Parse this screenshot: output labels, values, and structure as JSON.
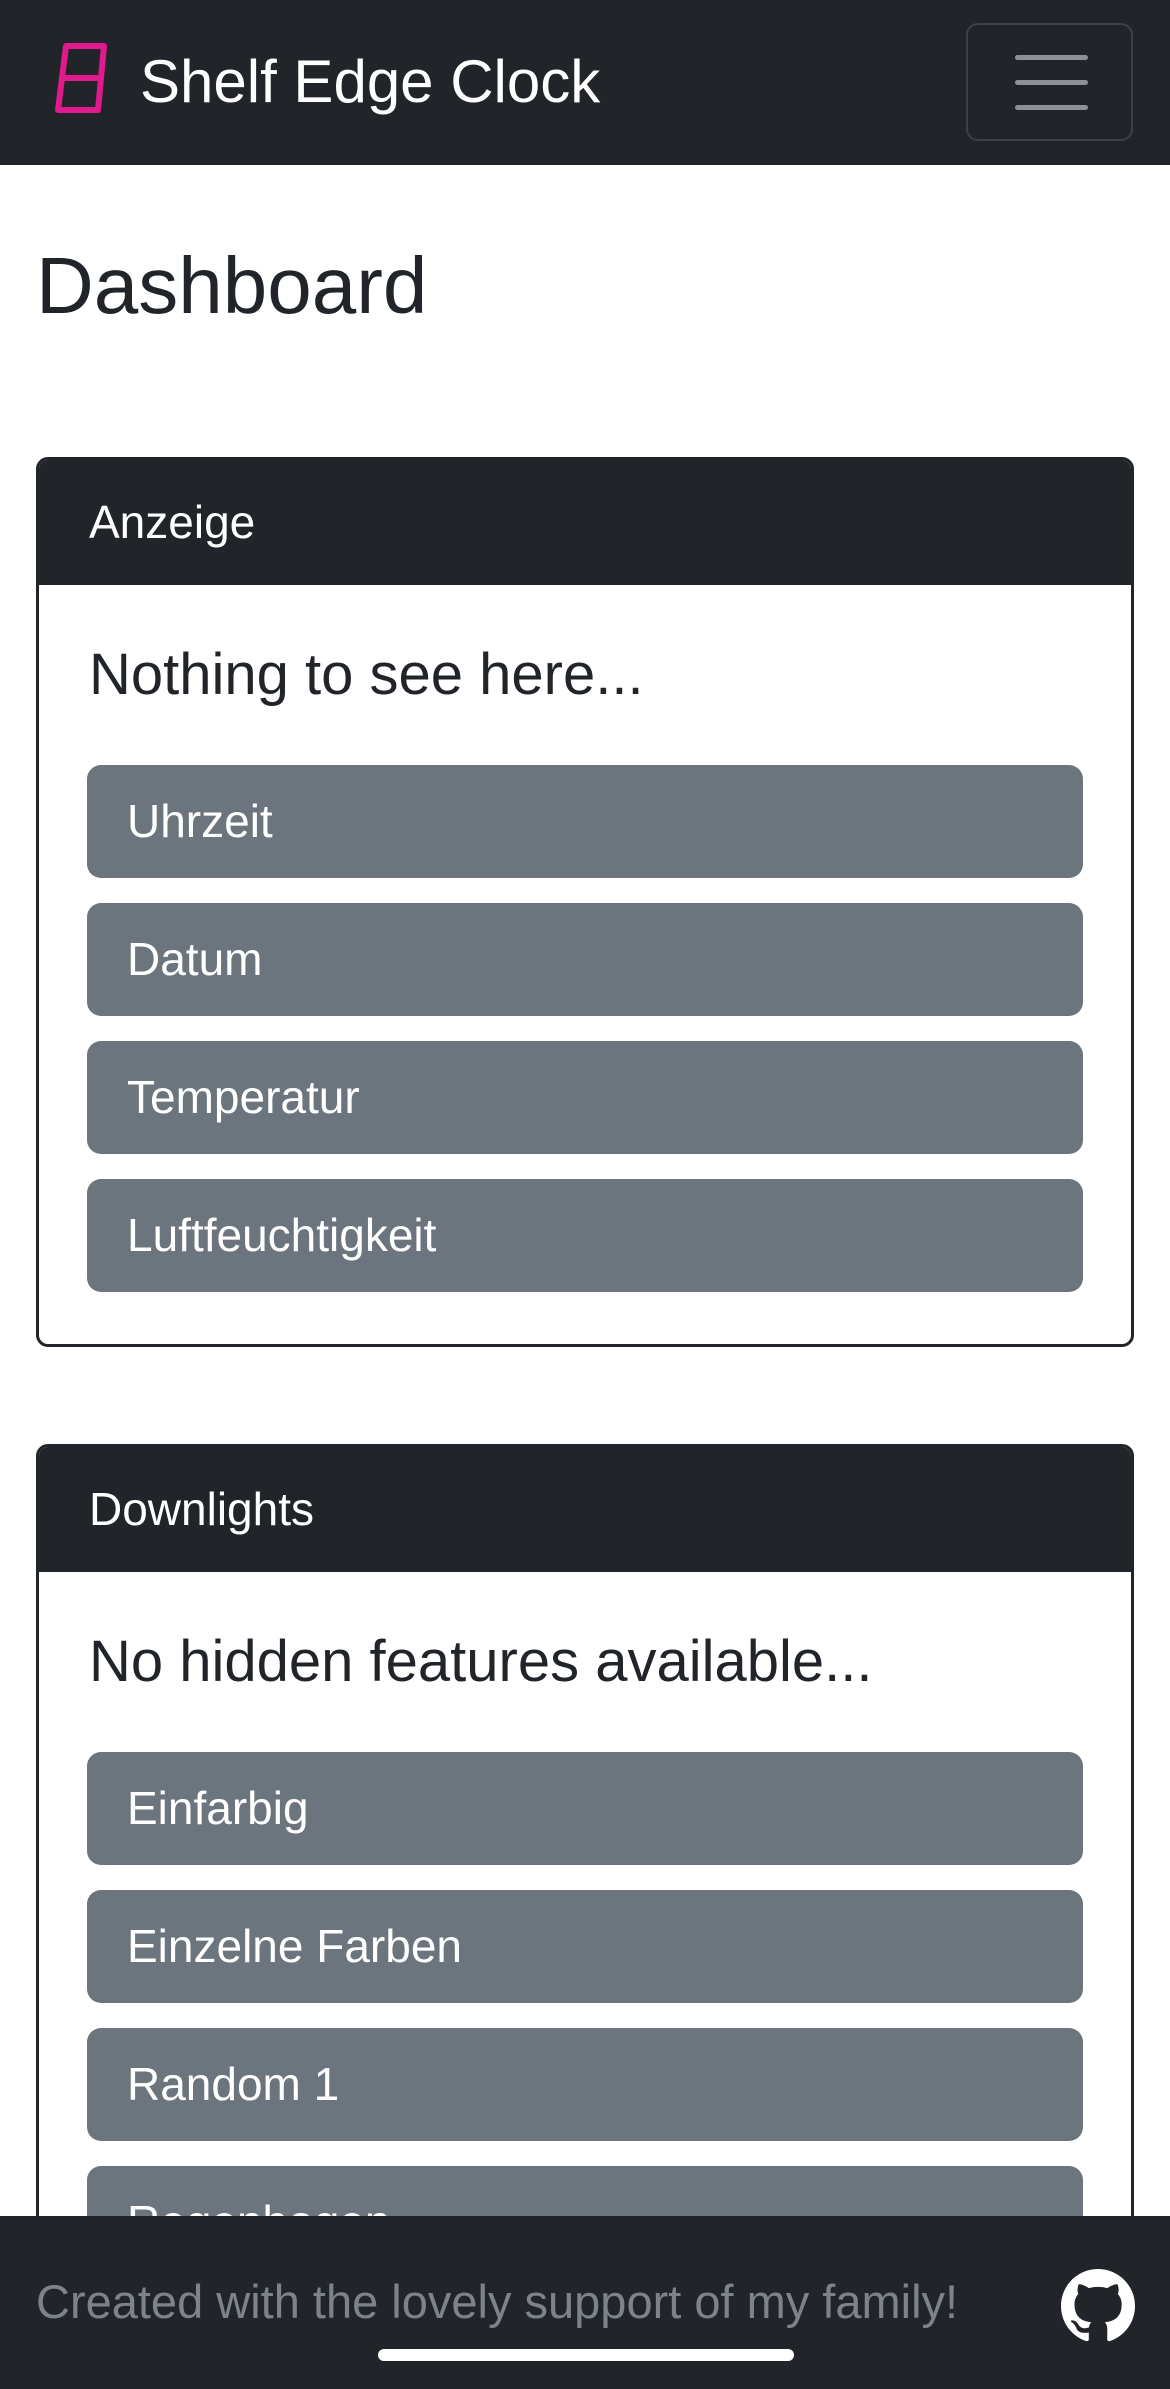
{
  "navbar": {
    "brand_icon": "seven-segment-digit-icon",
    "brand_color": "#e0198c",
    "title": "Shelf Edge Clock",
    "menu_icon": "hamburger-menu-icon"
  },
  "page": {
    "title": "Dashboard"
  },
  "cards": [
    {
      "header": "Anzeige",
      "text": "Nothing to see here...",
      "buttons": [
        "Uhrzeit",
        "Datum",
        "Temperatur",
        "Luftfeuchtigkeit"
      ]
    },
    {
      "header": "Downlights",
      "text": "No hidden features available...",
      "buttons": [
        "Einfarbig",
        "Einzelne Farben",
        "Random 1",
        "Regenbogen"
      ]
    }
  ],
  "footer": {
    "text": "Created with the lovely support of my family!",
    "icon": "github-icon"
  },
  "colors": {
    "dark": "#212529",
    "button": "#6c757d",
    "accent": "#e0198c"
  }
}
